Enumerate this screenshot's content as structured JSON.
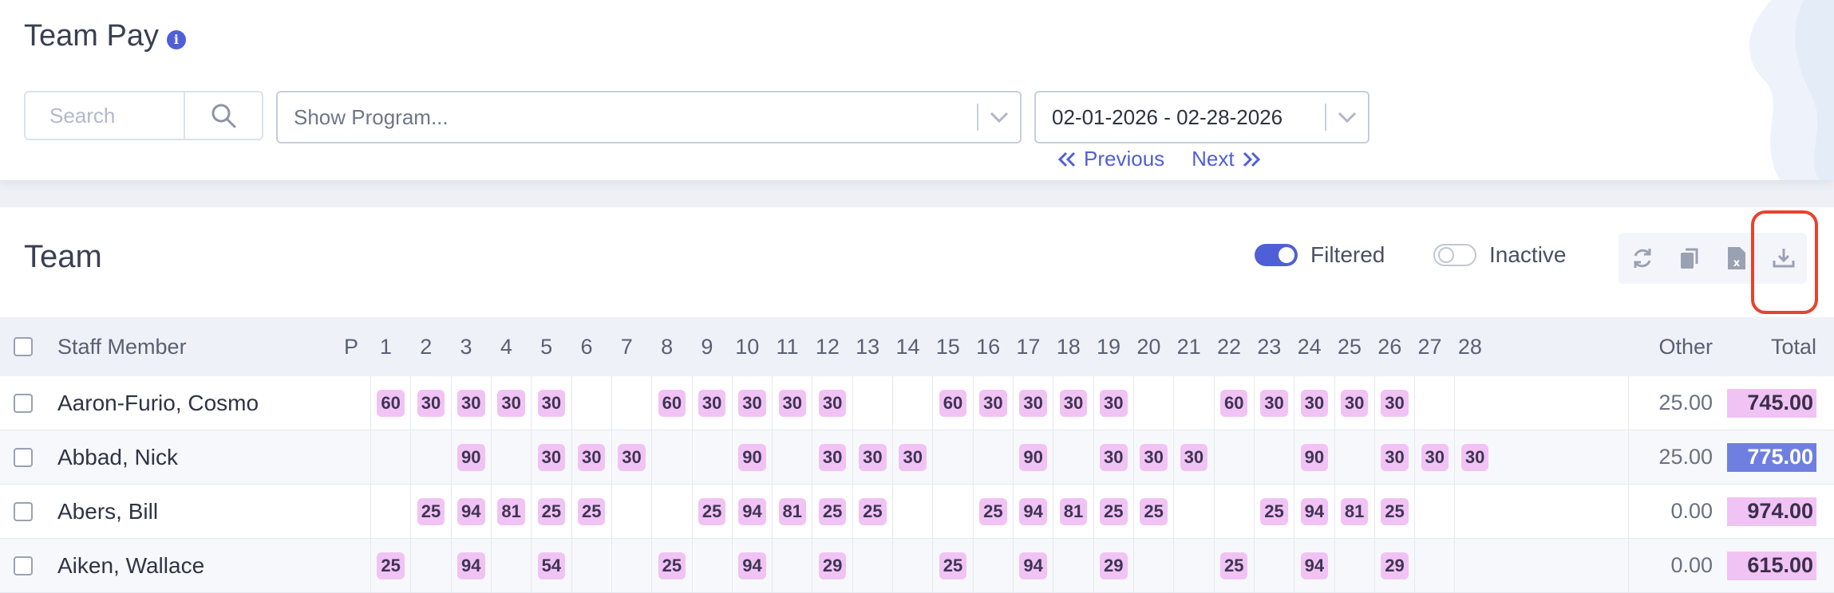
{
  "header": {
    "title": "Team Pay",
    "search": {
      "placeholder": "Search"
    },
    "program_select": {
      "value": "Show Program..."
    },
    "date_select": {
      "value": "02-01-2026 - 02-28-2026"
    },
    "nav": {
      "previous": "Previous",
      "next": "Next"
    }
  },
  "team": {
    "title": "Team",
    "filtered_label": "Filtered",
    "inactive_label": "Inactive",
    "filtered_on": true,
    "inactive_on": false,
    "actions": [
      "refresh-icon",
      "copy-icon",
      "excel-icon",
      "download-icon"
    ]
  },
  "table": {
    "headers": {
      "staff": "Staff Member",
      "p": "P",
      "days": [
        "1",
        "2",
        "3",
        "4",
        "5",
        "6",
        "7",
        "8",
        "9",
        "10",
        "11",
        "12",
        "13",
        "14",
        "15",
        "16",
        "17",
        "18",
        "19",
        "20",
        "21",
        "22",
        "23",
        "24",
        "25",
        "26",
        "27",
        "28"
      ],
      "other": "Other",
      "total": "Total"
    },
    "rows": [
      {
        "name": "Aaron-Furio, Cosmo",
        "days": [
          "60",
          "30",
          "30",
          "30",
          "30",
          "",
          "",
          "60",
          "30",
          "30",
          "30",
          "30",
          "",
          "",
          "60",
          "30",
          "30",
          "30",
          "30",
          "",
          "",
          "60",
          "30",
          "30",
          "30",
          "30",
          "",
          ""
        ],
        "other": "25.00",
        "total": "745.00",
        "total_style": "pink"
      },
      {
        "name": "Abbad, Nick",
        "days": [
          "",
          "",
          "90",
          "",
          "30",
          "30",
          "30",
          "",
          "",
          "90",
          "",
          "30",
          "30",
          "30",
          "",
          "",
          "90",
          "",
          "30",
          "30",
          "30",
          "",
          "",
          "90",
          "",
          "30",
          "30",
          "30"
        ],
        "other": "25.00",
        "total": "775.00",
        "total_style": "blue"
      },
      {
        "name": "Abers, Bill",
        "days": [
          "",
          "25",
          "94",
          "81",
          "25",
          "25",
          "",
          "",
          "25",
          "94",
          "81",
          "25",
          "25",
          "",
          "",
          "25",
          "94",
          "81",
          "25",
          "25",
          "",
          "",
          "25",
          "94",
          "81",
          "25",
          "",
          ""
        ],
        "other": "0.00",
        "total": "974.00",
        "total_style": "pink"
      },
      {
        "name": "Aiken, Wallace",
        "days": [
          "25",
          "",
          "94",
          "",
          "54",
          "",
          "",
          "25",
          "",
          "94",
          "",
          "29",
          "",
          "",
          "25",
          "",
          "94",
          "",
          "29",
          "",
          "",
          "25",
          "",
          "94",
          "",
          "29",
          "",
          ""
        ],
        "other": "0.00",
        "total": "615.00",
        "total_style": "pink"
      }
    ]
  },
  "colors": {
    "accent": "#4f5fd6",
    "badge": "#f1c3f4",
    "total_pink": "#f1c3f4",
    "total_blue": "#6f7fe0",
    "highlight": "#e8432e"
  }
}
